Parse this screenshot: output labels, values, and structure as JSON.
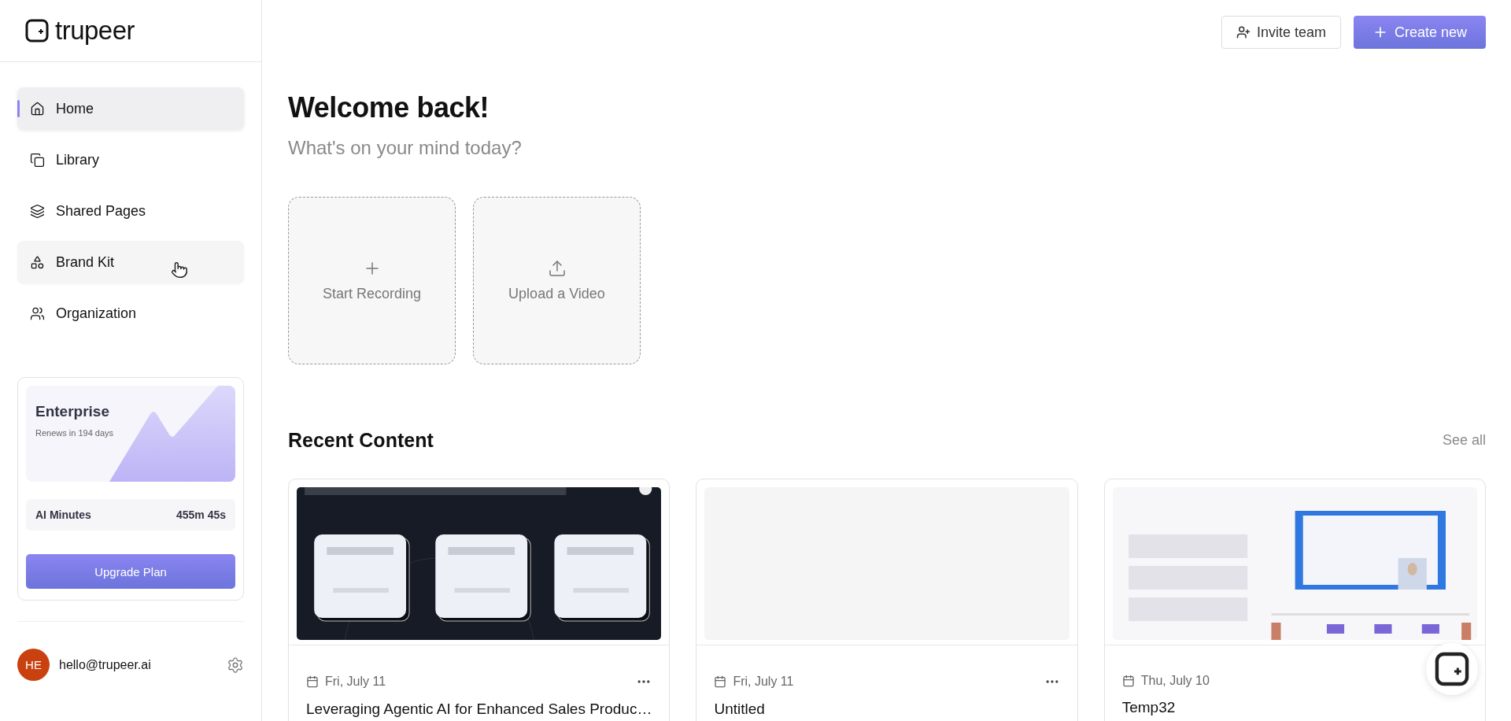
{
  "brand": {
    "name": "trupeer"
  },
  "sidebar": {
    "items": [
      {
        "label": "Home",
        "selected": true,
        "hovered": false
      },
      {
        "label": "Library",
        "selected": false,
        "hovered": false
      },
      {
        "label": "Shared Pages",
        "selected": false,
        "hovered": false
      },
      {
        "label": "Brand Kit",
        "selected": false,
        "hovered": true
      },
      {
        "label": "Organization",
        "selected": false,
        "hovered": false
      }
    ],
    "plan": {
      "name": "Enterprise",
      "renews": "Renews in 194 days",
      "minutes_label": "AI Minutes",
      "minutes_value": "455m 45s",
      "button": "Upgrade Plan"
    },
    "user": {
      "initials": "HE",
      "email": "hello@trupeer.ai"
    }
  },
  "header": {
    "invite": "Invite team",
    "create": "Create new"
  },
  "welcome": {
    "title": "Welcome back!",
    "subtitle": "What's on your mind today?"
  },
  "actions": [
    {
      "label": "Start Recording"
    },
    {
      "label": "Upload a Video"
    }
  ],
  "recent": {
    "title": "Recent Content",
    "see_all": "See all",
    "items": [
      {
        "date": "Fri, July 11",
        "title": "Leveraging Agentic AI for Enhanced Sales Produc…",
        "menu": true
      },
      {
        "date": "Fri, July 11",
        "title": "Untitled",
        "menu": true
      },
      {
        "date": "Thu, July 10",
        "title": "Temp32",
        "menu": false
      }
    ]
  }
}
